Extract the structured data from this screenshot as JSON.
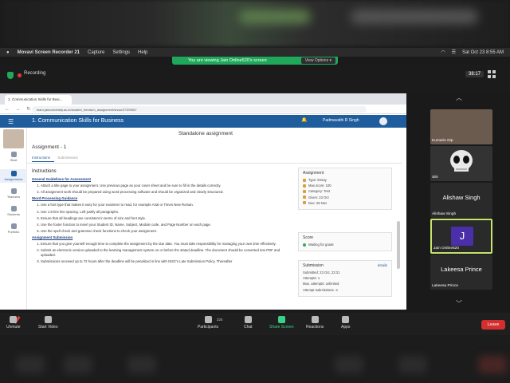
{
  "menubar": {
    "app": "Movavi Screen Recorder 21",
    "items": [
      "Capture",
      "Settings",
      "Help"
    ],
    "datetime": "Sat Oct 23  8:55 AM"
  },
  "share_banner": {
    "text": "You are viewing Jain Online520's screen",
    "view_options": "View Options ▾"
  },
  "zoom": {
    "recording": "Recording",
    "timer": "38:17"
  },
  "browser": {
    "tab_title": "1. Communication Skills for Busi...",
    "url": "learn.jainuniversity.ac.in/student_freedom_assignment/show/27399987",
    "nav": "← → ↻"
  },
  "app": {
    "course_title": "1. Communication Skills for Business",
    "user_name": "Padmavathi R Singh",
    "nav_items": [
      "Start",
      "Assignments",
      "Teachers",
      "Students",
      "Portfolio"
    ],
    "page_title": "Standalone assignment",
    "assignment_title": "Assignment - 1",
    "tabs": {
      "active": "Instructions",
      "inactive": "Submissions"
    }
  },
  "instructions": {
    "heading": "Instructions",
    "sec1_title": "General Guidelines for Assessment",
    "sec1_items": [
      "Attach a title page to your assignment. Use previous page as your cover sheet and be sure to fill in the details correctly.",
      "All assignment work should be prepared using word processing software and should be organized and clearly structured."
    ],
    "sec2_title": "Word Processing Guidance",
    "sec2_items": [
      "Use a font type that makes it easy for your examiner to read, for example Arial or Times New Roman.",
      "Use 1.5-line line spacing. Left justify all paragraphs.",
      "Ensure that all headings are consistent in terms of size and font style.",
      "Use the footer function to insert your Student ID, Name, Subject, Module code, and Page Number on each page.",
      "Use the spell check and grammar check functions to check your assignment."
    ],
    "sec3_title": "Assignment Submission",
    "sec3_items": [
      "Ensure that you give yourself enough time to complete the assignment by the due date. You must take responsibility for managing your own time effectively.",
      "Submit an electronic version uploaded to the learning management system on or before the stated deadline. The document should be converted into PDF and uploaded.",
      "Submissions received up to 72 hours after the deadline will be penalized in line with ISSC's Late Submission Policy. Thereafter"
    ]
  },
  "side_assignment": {
    "heading": "Assignment",
    "rows": [
      "Type: Essay",
      "Max score: 100",
      "Category: Test",
      "Given: 23 Oct",
      "Due: 25 Nov"
    ]
  },
  "side_score": {
    "heading": "Score",
    "status": "Waiting for grade"
  },
  "side_submission": {
    "heading": "Submission",
    "details": "details",
    "rows": [
      "Submitted: 23 Oct, 23:31",
      "Attempts: 1",
      "Max. attempts: unlimited",
      "Attempt submissions: ✕"
    ]
  },
  "participants": [
    {
      "name": "Kumarie Dip",
      "kind": "photo"
    },
    {
      "name": "Siik",
      "kind": "skull"
    },
    {
      "name": "Alishaw Singh",
      "big": "Alishaw Singh",
      "kind": "name"
    },
    {
      "name": "Jain Online520",
      "initial": "J",
      "kind": "active"
    },
    {
      "name": "Lakeesa Prince",
      "big": "Lakeesa Prince",
      "kind": "name"
    }
  ],
  "toolbar": {
    "unmute": "Unmute",
    "start_video": "Start Video",
    "participants": "Participants",
    "participants_count": "224",
    "chat": "Chat",
    "share_screen": "Share Screen",
    "reactions": "Reactions",
    "apps": "Apps",
    "leave": "Leave"
  }
}
